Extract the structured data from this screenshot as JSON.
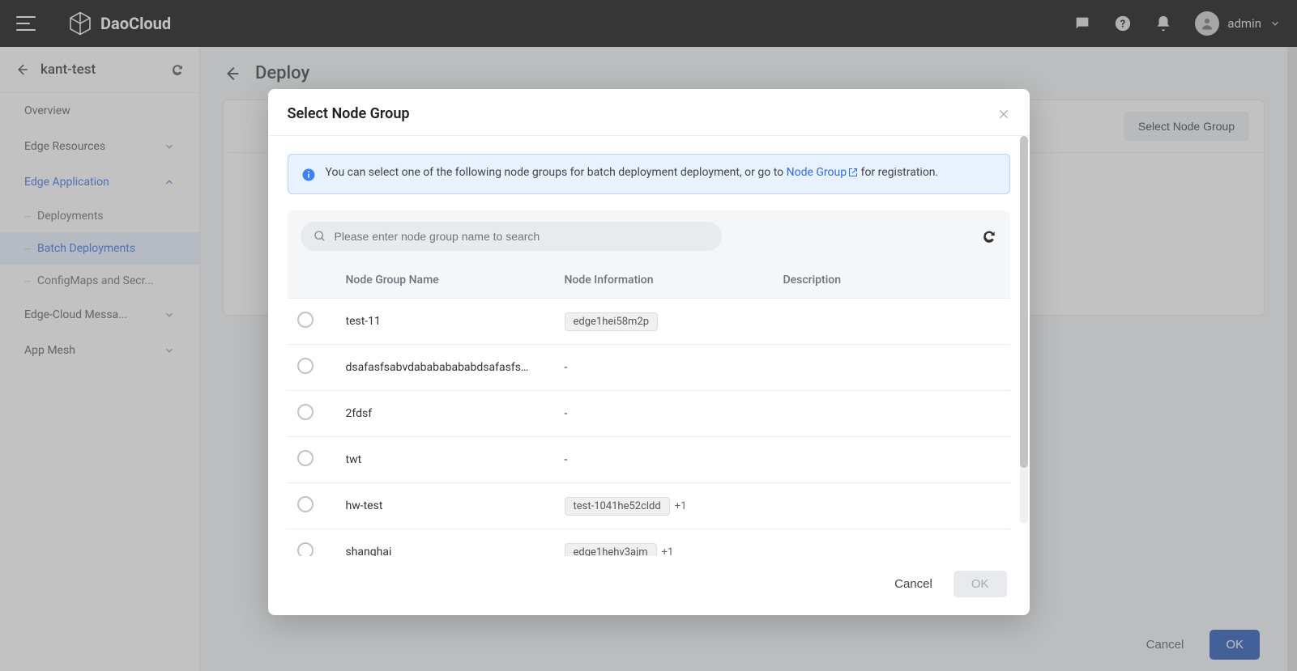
{
  "brand": "DaoCloud",
  "topbar": {
    "username": "admin"
  },
  "sidebar": {
    "title": "kant-test",
    "items": [
      {
        "label": "Overview"
      },
      {
        "label": "Edge Resources"
      },
      {
        "label": "Edge Application"
      },
      {
        "label": "Deployments"
      },
      {
        "label": "Batch Deployments"
      },
      {
        "label": "ConfigMaps and Secr..."
      },
      {
        "label": "Edge-Cloud Messa..."
      },
      {
        "label": "App Mesh"
      }
    ]
  },
  "main": {
    "title": "Deploy",
    "select_btn": "Select Node Group",
    "cancel": "Cancel",
    "ok": "OK"
  },
  "modal": {
    "title": "Select Node Group",
    "info_pre": "You can select one of the following node groups for batch deployment deployment, or go to ",
    "info_link": "Node Group",
    "info_post": " for registration.",
    "search_placeholder": "Please enter node group name to search",
    "columns": {
      "name": "Node Group Name",
      "info": "Node Information",
      "desc": "Description"
    },
    "rows": [
      {
        "name": "test-11",
        "info_tag": "edge1hei58m2p",
        "more": "",
        "desc": ""
      },
      {
        "name": "dsafasfsabvdabababababdsafasfsab...",
        "info_text": "-",
        "desc": ""
      },
      {
        "name": "2fdsf",
        "info_text": "-",
        "desc": ""
      },
      {
        "name": "twt",
        "info_text": "-",
        "desc": ""
      },
      {
        "name": "hw-test",
        "info_tag": "test-1041he52cldd",
        "more": "+1",
        "desc": ""
      },
      {
        "name": "shanghai",
        "info_tag": "edge1hehv3ajm",
        "more": "+1",
        "desc": ""
      }
    ],
    "cancel": "Cancel",
    "ok": "OK"
  }
}
